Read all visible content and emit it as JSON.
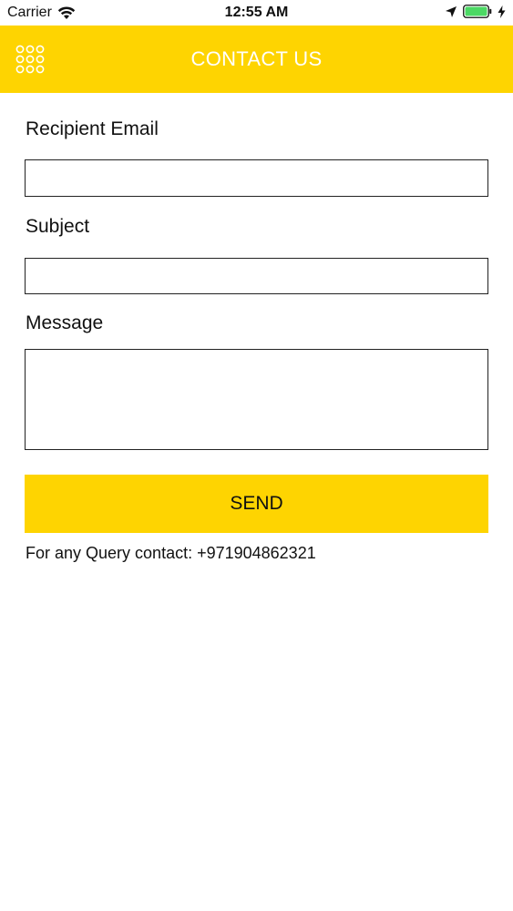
{
  "status_bar": {
    "carrier": "Carrier",
    "time": "12:55 AM",
    "icons": [
      "wifi-icon",
      "location-arrow-icon",
      "battery-icon",
      "charging-bolt-icon"
    ]
  },
  "header": {
    "title": "CONTACT US",
    "menu_icon": "grid-dots-icon",
    "background_color": "#fed401",
    "title_color": "#ffffff"
  },
  "form": {
    "recipient_email": {
      "label": "Recipient Email",
      "value": "",
      "placeholder": ""
    },
    "subject": {
      "label": "Subject",
      "value": "",
      "placeholder": ""
    },
    "message": {
      "label": "Message",
      "value": "",
      "placeholder": ""
    },
    "send_label": "SEND",
    "send_color": "#fed401"
  },
  "footer": {
    "contact_text": "For any Query contact: +971904862321"
  }
}
